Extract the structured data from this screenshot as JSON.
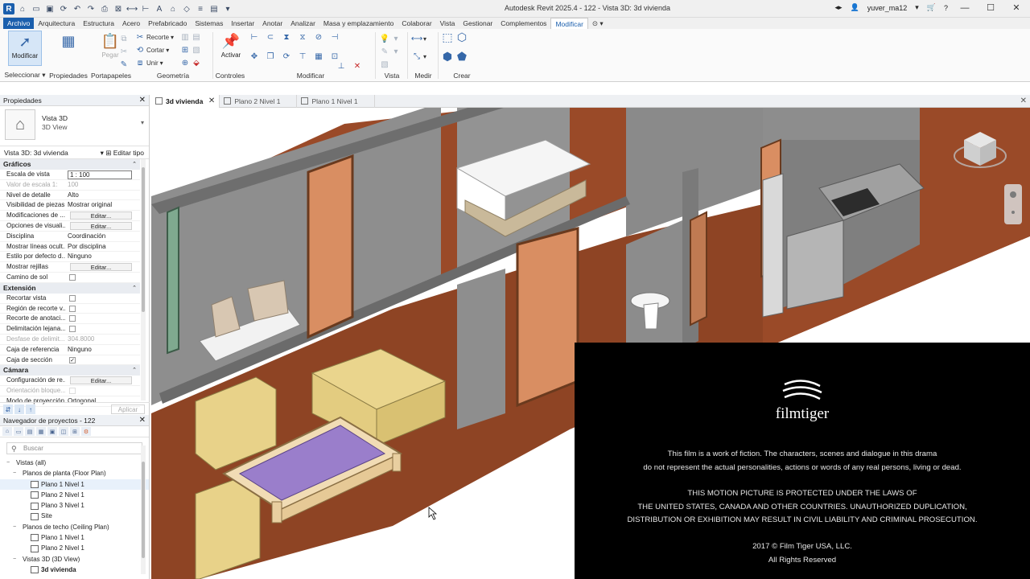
{
  "window": {
    "title": "Autodesk Revit 2025.4 - 122 - Vista 3D: 3d vivienda",
    "user": "yuver_ma12",
    "help": "?"
  },
  "menu": {
    "file": "Archivo",
    "tabs": [
      "Arquitectura",
      "Estructura",
      "Acero",
      "Prefabricado",
      "Sistemas",
      "Insertar",
      "Anotar",
      "Analizar",
      "Masa y emplazamiento",
      "Colaborar",
      "Vista",
      "Gestionar",
      "Complementos",
      "Modificar"
    ],
    "active_tab": "Modificar"
  },
  "ribbon": {
    "modify_btn": "Modificar",
    "paste_btn": "Pegar",
    "activate_btn": "Activar",
    "cut": "Recorte",
    "cope": "Cortar",
    "join": "Unir",
    "groups": {
      "select": "Seleccionar",
      "properties": "Propiedades",
      "clipboard": "Portapapeles",
      "geometry": "Geometría",
      "controls": "Controles",
      "modify": "Modificar",
      "view": "Vista",
      "measure": "Medir",
      "create": "Crear"
    }
  },
  "properties": {
    "title": "Propiedades",
    "type_name": "Vista 3D",
    "type_sub": "3D View",
    "instance": "Vista 3D: 3d vivienda",
    "edit_type": "Editar tipo",
    "apply": "Aplicar",
    "sections": [
      {
        "name": "Gráficos",
        "rows": [
          {
            "k": "Escala de vista",
            "v": "1 : 100",
            "kind": "input"
          },
          {
            "k": "Valor de escala    1:",
            "v": "100",
            "kind": "disabled"
          },
          {
            "k": "Nivel de detalle",
            "v": "Alto"
          },
          {
            "k": "Visibilidad de piezas",
            "v": "Mostrar original"
          },
          {
            "k": "Modificaciones de ...",
            "v": "Editar...",
            "kind": "button"
          },
          {
            "k": "Opciones de visuali...",
            "v": "Editar...",
            "kind": "button"
          },
          {
            "k": "Disciplina",
            "v": "Coordinación"
          },
          {
            "k": "Mostrar líneas ocult...",
            "v": "Por disciplina"
          },
          {
            "k": "Estilo por defecto d...",
            "v": "Ninguno"
          },
          {
            "k": "Mostrar rejillas",
            "v": "Editar...",
            "kind": "button"
          },
          {
            "k": "Camino de sol",
            "v": "",
            "kind": "check"
          }
        ]
      },
      {
        "name": "Extensión",
        "rows": [
          {
            "k": "Recortar vista",
            "v": "",
            "kind": "check"
          },
          {
            "k": "Región de recorte v...",
            "v": "",
            "kind": "check"
          },
          {
            "k": "Recorte de anotaci...",
            "v": "",
            "kind": "check"
          },
          {
            "k": "Delimitación lejana...",
            "v": "",
            "kind": "check"
          },
          {
            "k": "Desfase de delimit...",
            "v": "304.8000",
            "kind": "disabled"
          },
          {
            "k": "Caja de referencia",
            "v": "Ninguno"
          },
          {
            "k": "Caja de sección",
            "v": "",
            "kind": "check-on"
          }
        ]
      },
      {
        "name": "Cámara",
        "rows": [
          {
            "k": "Configuración de re...",
            "v": "Editar...",
            "kind": "button"
          },
          {
            "k": "Orientación bloque...",
            "v": "",
            "kind": "check-dis"
          },
          {
            "k": "Modo de proyección",
            "v": "Ortogonal"
          }
        ]
      }
    ]
  },
  "browser": {
    "title": "Navegador de proyectos - 122",
    "search_placeholder": "Buscar",
    "tree": [
      {
        "label": "Vistas (all)",
        "level": 0,
        "twisty": "−"
      },
      {
        "label": "Planos de planta (Floor Plan)",
        "level": 1,
        "twisty": "−"
      },
      {
        "label": "Plano 1 Nivel 1",
        "level": 2,
        "icon": true,
        "hl": true
      },
      {
        "label": "Plano 2 Nivel 1",
        "level": 2,
        "icon": true
      },
      {
        "label": "Plano 3 Nivel 1",
        "level": 2,
        "icon": true
      },
      {
        "label": "Site",
        "level": 2,
        "icon": true
      },
      {
        "label": "Planos de techo (Ceiling Plan)",
        "level": 1,
        "twisty": "−"
      },
      {
        "label": "Plano 1 Nivel 1",
        "level": 2,
        "icon": true
      },
      {
        "label": "Plano 2 Nivel 1",
        "level": 2,
        "icon": true
      },
      {
        "label": "Vistas 3D (3D View)",
        "level": 1,
        "twisty": "−"
      },
      {
        "label": "3d vivienda",
        "level": 2,
        "icon": true,
        "bold": true
      }
    ]
  },
  "view_tabs": [
    {
      "label": "3d vivienda",
      "active": true
    },
    {
      "label": "Plano 2 Nivel 1",
      "active": false
    },
    {
      "label": "Plano 1 Nivel 1",
      "active": false
    }
  ],
  "film": {
    "brand": "filmtiger",
    "lines1": [
      "This film is a work of fiction. The characters, scenes and dialogue in this drama",
      "do not represent the actual personalities, actions or words of any real persons, living or dead."
    ],
    "lines2": [
      "THIS MOTION PICTURE IS PROTECTED UNDER THE LAWS OF",
      "THE UNITED STATES, CANADA AND OTHER COUNTRIES. UNAUTHORIZED DUPLICATION,",
      "DISTRIBUTION OR EXHIBITION MAY RESULT IN CIVIL LIABILITY AND CRIMINAL PROSECUTION."
    ],
    "lines3": [
      "2017 © Film Tiger USA, LLC.",
      "All Rights Reserved"
    ]
  },
  "colors": {
    "accent": "#1b5fad",
    "floor": "#8a3b1e",
    "wall": "#8c8c8c",
    "sofa": "#e5cf86",
    "table_top": "#9a7ecb"
  }
}
